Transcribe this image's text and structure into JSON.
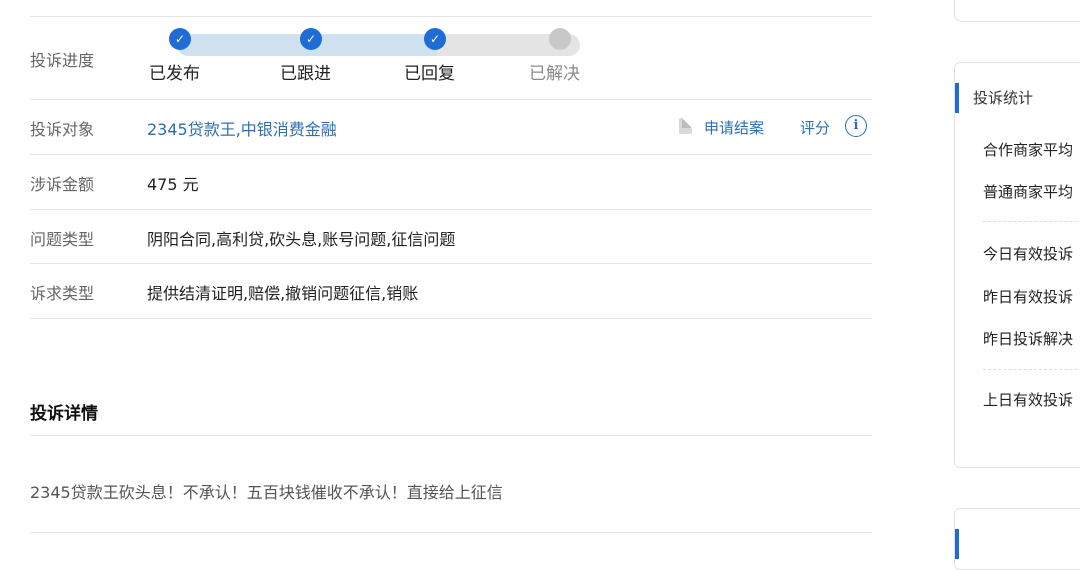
{
  "progress": {
    "label": "投诉进度",
    "steps": [
      {
        "label": "已发布",
        "done": true
      },
      {
        "label": "已跟进",
        "done": true
      },
      {
        "label": "已回复",
        "done": true
      },
      {
        "label": "已解决",
        "done": false
      }
    ],
    "check_glyph": "✓"
  },
  "target": {
    "label": "投诉对象",
    "value": "2345贷款王,中银消费金融",
    "apply_close": "申请结案",
    "rate": "评分",
    "info_glyph": "i"
  },
  "amount": {
    "label": "涉诉金额",
    "value": "475 元"
  },
  "issue_type": {
    "label": "问题类型",
    "value": "阴阳合同,高利贷,砍头息,账号问题,征信问题"
  },
  "demand_type": {
    "label": "诉求类型",
    "value": "提供结清证明,赔偿,撤销问题征信,销账"
  },
  "details": {
    "title": "投诉详情",
    "text": "2345贷款王砍头息！不承认！五百块钱催收不承认！直接给上征信"
  },
  "sidebar": {
    "title": "投诉统计",
    "items": [
      "合作商家平均",
      "普通商家平均",
      "今日有效投诉",
      "昨日有效投诉",
      "昨日投诉解决",
      "上日有效投诉"
    ]
  },
  "colors": {
    "accent": "#1f6cd6",
    "link": "#2f6fb0",
    "pending": "#c8c8c8"
  }
}
